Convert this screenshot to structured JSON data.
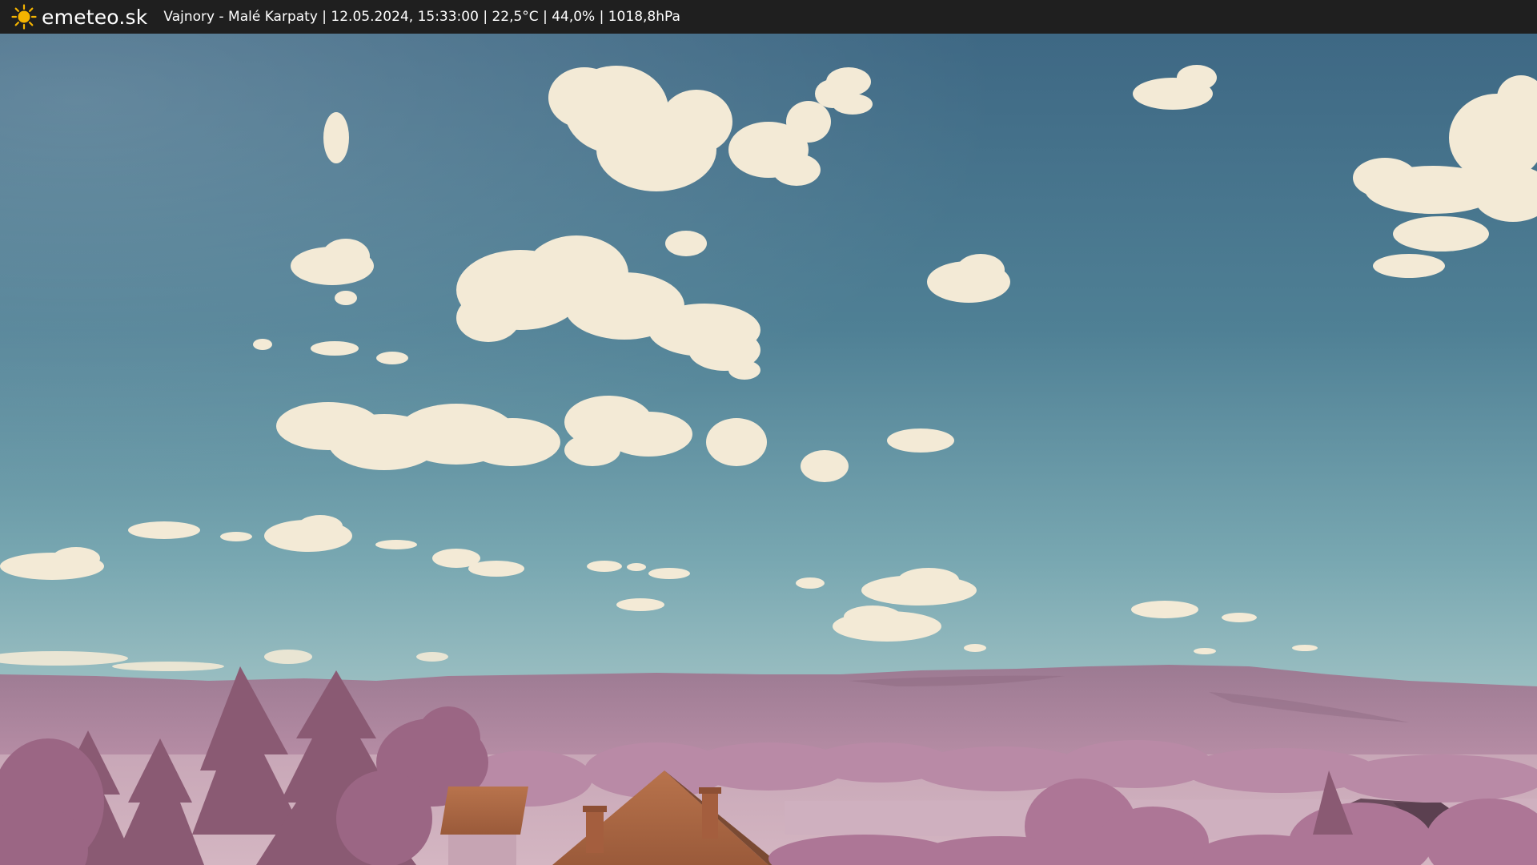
{
  "header": {
    "brand": "emeteo.sk",
    "logo_icon": "sun-icon",
    "status_line": "Vajnory - Malé Karpaty | 12.05.2024, 15:33:00 | 22,5°C | 44,0% | 1018,8hPa"
  },
  "colors": {
    "bar_background": "#1f1f1f",
    "sun_color": "#f5b400",
    "sky_top": "#3f6a86",
    "sky_horizon": "#86b2bb",
    "cloud": "#f4ecd9",
    "hills": "#a17e94",
    "foliage": "#b57f9f",
    "roof": "#b06a45"
  }
}
